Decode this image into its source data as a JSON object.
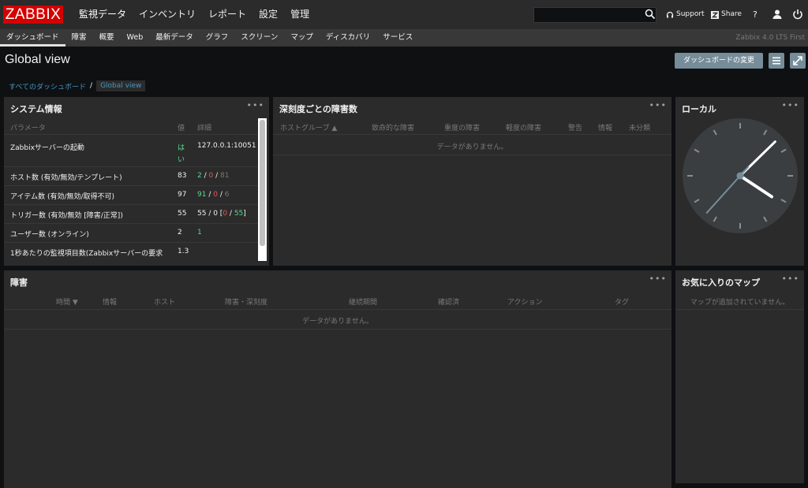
{
  "logo": "ZABBIX",
  "main_nav": [
    "監視データ",
    "インベントリ",
    "レポート",
    "設定",
    "管理"
  ],
  "search": {
    "value": "",
    "placeholder": ""
  },
  "top_links": {
    "support": "Support",
    "share": "Share",
    "help": "?"
  },
  "sub_nav": [
    "ダッシュボード",
    "障害",
    "概要",
    "Web",
    "最新データ",
    "グラフ",
    "スクリーン",
    "マップ",
    "ディスカバリ",
    "サービス"
  ],
  "version": "Zabbix 4.0 LTS First",
  "page_title": "Global view",
  "buttons": {
    "edit_dashboard": "ダッシュボードの変更"
  },
  "breadcrumb": {
    "root": "すべてのダッシュボード",
    "separator": "/",
    "current": "Global view"
  },
  "widgets": {
    "system_info": {
      "title": "システム情報",
      "menu": "•••",
      "headers": {
        "param": "パラメータ",
        "value": "値",
        "details": "詳細"
      },
      "rows": [
        {
          "param": "Zabbixサーバーの起動",
          "value_l1": "は",
          "value_l2": "い",
          "detail": "127.0.0.1:10051"
        },
        {
          "param": "ホスト数 (有効/無効/テンプレート)",
          "value": "83",
          "d1": "2",
          "d2": "0",
          "d3": "81",
          "sep": " / "
        },
        {
          "param": "アイテム数 (有効/無効/取得不可)",
          "value": "97",
          "d1": "91",
          "d2": "0",
          "d3": "6",
          "sep": " / "
        },
        {
          "param": "トリガー数 (有効/無効 [障害/正常])",
          "value": "55",
          "d1": "55 / 0 [",
          "d2": "0",
          "d3": "55",
          "sep": " / ",
          "end": "]"
        },
        {
          "param": "ユーザー数 (オンライン)",
          "value": "2",
          "d1": "1"
        },
        {
          "param": "1秒あたりの監視項目数(Zabbixサーバーの要求",
          "value": "1.3"
        }
      ]
    },
    "severity": {
      "title": "深刻度ごとの障害数",
      "menu": "•••",
      "headers": [
        "ホストグループ ▲",
        "致命的な障害",
        "重度の障害",
        "軽度の障害",
        "警告",
        "情報",
        "未分類"
      ],
      "empty": "データがありません。"
    },
    "clock": {
      "title": "ローカル",
      "menu": "•••",
      "hour": 4,
      "minute": 7,
      "second": 37
    },
    "problems": {
      "title": "障害",
      "menu": "•••",
      "headers": [
        "時間 ▼",
        "情報",
        "ホスト",
        "障害・深刻度",
        "継続期間",
        "確認済",
        "アクション",
        "タグ"
      ],
      "empty": "データがありません。"
    },
    "fav_maps": {
      "title": "お気に入りのマップ",
      "menu": "•••",
      "empty": "マップが追加されていません。"
    }
  },
  "colors": {
    "accent": "#768d99",
    "brand": "#d40000",
    "ok": "#59db8f",
    "problem": "#e45959",
    "link": "#4796c4"
  }
}
